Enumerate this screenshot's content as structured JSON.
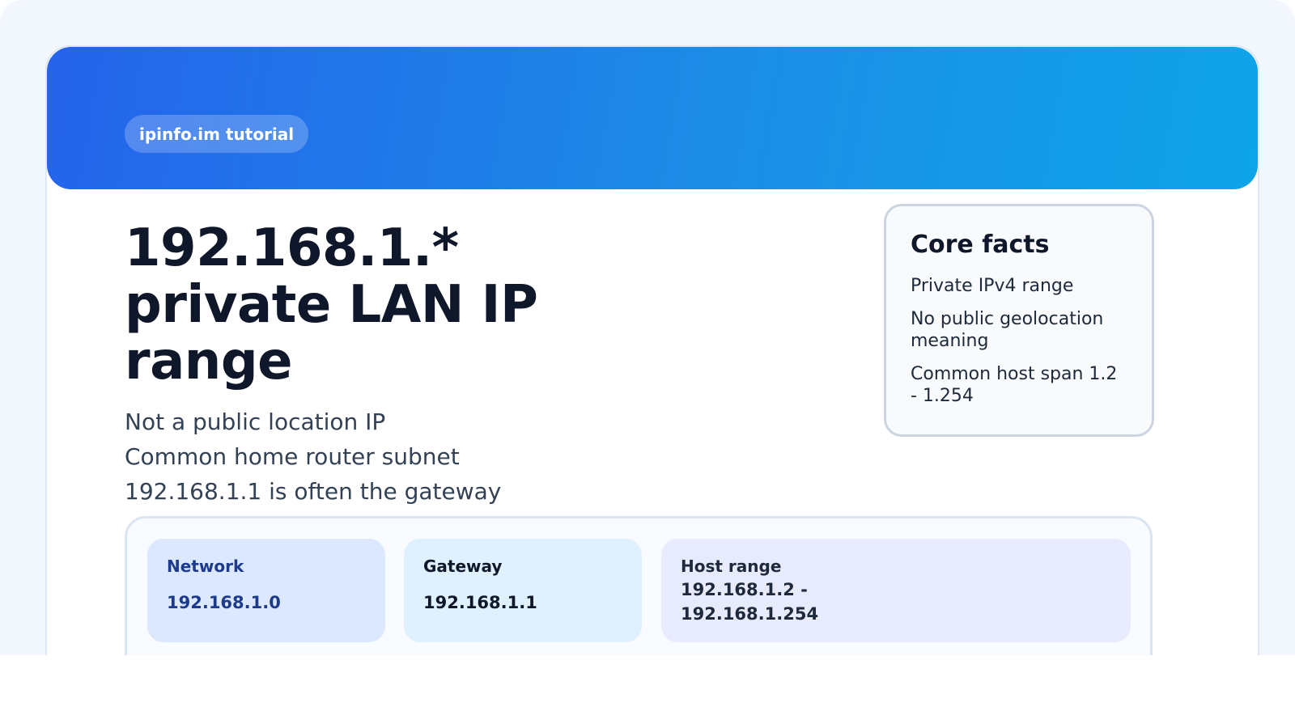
{
  "badge": "ipinfo.im tutorial",
  "title": "192.168.1.* private LAN IP range",
  "subtitles": [
    "Not a public location IP",
    "Common home router subnet",
    "192.168.1.1 is often the gateway"
  ],
  "core_facts": {
    "title": "Core facts",
    "items": [
      "Private IPv4 range",
      "No public geolocation meaning",
      "Common host span 1.2 - 1.254"
    ]
  },
  "stats": {
    "network": {
      "label": "Network",
      "value": "192.168.1.0"
    },
    "gateway": {
      "label": "Gateway",
      "value": "192.168.1.1"
    },
    "host_range": {
      "label": "Host range",
      "value": "192.168.1.2 - 192.168.1.254"
    }
  },
  "colors": {
    "banner_start": "#2563eb",
    "banner_end": "#0ea5e9",
    "title_text": "#0f172a",
    "network_card": "#dbe8fd",
    "gateway_card": "#dff1fe",
    "host_card": "#e8ebfd"
  }
}
